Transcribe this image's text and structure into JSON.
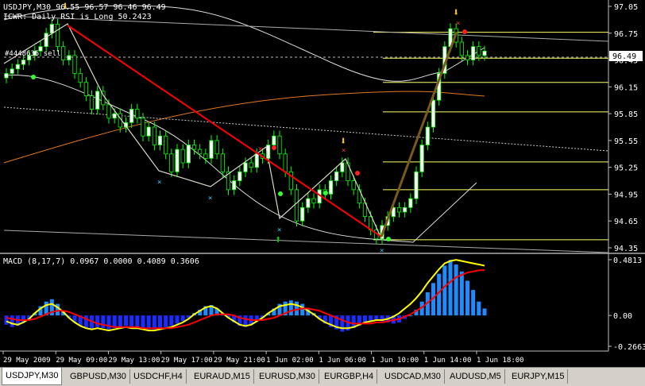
{
  "window": {
    "title": "USDJPY,M30  96.55 96.57 96.46 96.49",
    "indicator_line": "ICWR: Daily RSI is Long 50.2423",
    "order_label": "#4448635 sell"
  },
  "colors": {
    "background": "#000000",
    "grid": "#3a3a3a",
    "bull_candle": "#ffffff",
    "bear_candle": "#000000",
    "candle_outline": "#00ff00",
    "fib_lines": "#ffff66",
    "trend_red": "#ff0000",
    "zigzag": "#d8d8c8",
    "macd_hist": "#1e64ff",
    "macd_line": "#ffff00",
    "signal_line": "#ff0000"
  },
  "price_axis": {
    "labels": [
      "97.05",
      "96.75",
      "96.45",
      "96.15",
      "95.85",
      "95.55",
      "95.25",
      "94.95",
      "94.65",
      "94.35"
    ],
    "current_price": "96.49"
  },
  "macd_panel": {
    "title": "MACD  (8,17,7) 0.0967 0.0000 0.4089 0.3606",
    "axis_labels": [
      "0.4813",
      "0.00",
      "-0.2663"
    ]
  },
  "time_axis": {
    "labels": [
      "29 May 2009",
      "29 May 09:00",
      "29 May 13:00",
      "29 May 17:00",
      "29 May 21:00",
      "1 Jun 02:00",
      "1 Jun 06:00",
      "1 Jun 10:00",
      "1 Jun 14:00",
      "1 Jun 18:00"
    ]
  },
  "tabs": [
    {
      "label": "USDJPY,M30",
      "active": true
    },
    {
      "label": "GBPUSD,M30",
      "active": false
    },
    {
      "label": "USDCHF,H4",
      "active": false
    },
    {
      "label": "EURAUD,M15",
      "active": false
    },
    {
      "label": "EURUSD,M30",
      "active": false
    },
    {
      "label": "EURGBP,H4",
      "active": false
    },
    {
      "label": "USDCAD,M30",
      "active": false
    },
    {
      "label": "AUDUSD,M5",
      "active": false
    },
    {
      "label": "EURJPY,M15",
      "active": false
    }
  ],
  "chart_data": {
    "type": "candlestick",
    "symbol": "USDJPY",
    "timeframe": "M30",
    "ylim": [
      94.3,
      97.1
    ],
    "fib_levels": [
      96.76,
      96.47,
      96.2,
      95.87,
      95.31,
      95.0,
      94.44
    ],
    "closes": [
      96.3,
      96.35,
      96.4,
      96.45,
      96.5,
      96.55,
      96.6,
      96.75,
      96.85,
      96.6,
      96.45,
      96.5,
      96.3,
      96.2,
      96.05,
      95.9,
      96.1,
      95.95,
      95.8,
      95.85,
      95.7,
      95.75,
      95.9,
      95.8,
      95.6,
      95.7,
      95.5,
      95.6,
      95.4,
      95.2,
      95.45,
      95.3,
      95.5,
      95.45,
      95.4,
      95.35,
      95.55,
      95.4,
      95.2,
      95.0,
      95.1,
      95.2,
      95.3,
      95.25,
      95.4,
      95.35,
      95.5,
      95.6,
      95.4,
      95.2,
      95.0,
      94.65,
      94.8,
      94.9,
      94.85,
      95.0,
      94.95,
      95.1,
      95.2,
      95.3,
      95.1,
      95.0,
      94.85,
      94.7,
      94.55,
      94.45,
      94.6,
      94.7,
      94.8,
      94.75,
      94.8,
      94.9,
      95.2,
      95.5,
      95.7,
      96.0,
      96.3,
      96.6,
      96.8,
      96.65,
      96.5,
      96.45,
      96.6,
      96.5,
      96.55
    ],
    "macd_hist": [
      -0.08,
      -0.1,
      -0.09,
      -0.06,
      -0.03,
      0.02,
      0.08,
      0.12,
      0.14,
      0.1,
      0.04,
      -0.02,
      -0.06,
      -0.09,
      -0.11,
      -0.12,
      -0.1,
      -0.11,
      -0.12,
      -0.11,
      -0.1,
      -0.09,
      -0.1,
      -0.1,
      -0.11,
      -0.12,
      -0.12,
      -0.11,
      -0.1,
      -0.09,
      -0.07,
      -0.05,
      -0.02,
      0.02,
      0.05,
      0.08,
      0.09,
      0.06,
      0.02,
      -0.02,
      -0.06,
      -0.09,
      -0.1,
      -0.08,
      -0.05,
      -0.02,
      0.02,
      0.06,
      0.1,
      0.12,
      0.13,
      0.12,
      0.1,
      0.06,
      0.02,
      -0.03,
      -0.07,
      -0.1,
      -0.12,
      -0.14,
      -0.13,
      -0.11,
      -0.09,
      -0.07,
      -0.05,
      -0.04,
      -0.05,
      -0.06,
      -0.07,
      -0.06,
      -0.03,
      0.0,
      0.05,
      0.12,
      0.2,
      0.28,
      0.36,
      0.43,
      0.48,
      0.44,
      0.38,
      0.3,
      0.22,
      0.12,
      0.06
    ],
    "macd_line": [
      -0.05,
      -0.07,
      -0.08,
      -0.06,
      -0.03,
      0.02,
      0.06,
      0.09,
      0.1,
      0.07,
      0.03,
      -0.02,
      -0.06,
      -0.09,
      -0.11,
      -0.12,
      -0.11,
      -0.12,
      -0.13,
      -0.12,
      -0.11,
      -0.1,
      -0.11,
      -0.11,
      -0.12,
      -0.13,
      -0.13,
      -0.12,
      -0.11,
      -0.1,
      -0.08,
      -0.06,
      -0.03,
      0.01,
      0.04,
      0.07,
      0.08,
      0.06,
      0.02,
      -0.02,
      -0.05,
      -0.08,
      -0.09,
      -0.08,
      -0.05,
      -0.02,
      0.02,
      0.05,
      0.08,
      0.09,
      0.1,
      0.09,
      0.07,
      0.04,
      0.01,
      -0.03,
      -0.06,
      -0.08,
      -0.1,
      -0.11,
      -0.11,
      -0.1,
      -0.08,
      -0.06,
      -0.05,
      -0.04,
      -0.04,
      -0.03,
      -0.01,
      0.02,
      0.06,
      0.1,
      0.15,
      0.21,
      0.28,
      0.34,
      0.4,
      0.45,
      0.47,
      0.48,
      0.47,
      0.46,
      0.45,
      0.44,
      0.43
    ],
    "signal_line": [
      -0.02,
      -0.03,
      -0.04,
      -0.04,
      -0.04,
      -0.03,
      -0.01,
      0.01,
      0.03,
      0.04,
      0.04,
      0.03,
      0.01,
      -0.01,
      -0.03,
      -0.05,
      -0.07,
      -0.08,
      -0.09,
      -0.1,
      -0.1,
      -0.1,
      -0.1,
      -0.1,
      -0.11,
      -0.11,
      -0.11,
      -0.11,
      -0.11,
      -0.11,
      -0.1,
      -0.09,
      -0.08,
      -0.06,
      -0.04,
      -0.02,
      0.0,
      0.01,
      0.01,
      0.01,
      0.0,
      -0.02,
      -0.03,
      -0.04,
      -0.04,
      -0.04,
      -0.03,
      -0.02,
      0.0,
      0.02,
      0.04,
      0.05,
      0.06,
      0.06,
      0.05,
      0.04,
      0.02,
      0.0,
      -0.02,
      -0.04,
      -0.06,
      -0.07,
      -0.07,
      -0.07,
      -0.07,
      -0.06,
      -0.06,
      -0.05,
      -0.04,
      -0.03,
      -0.01,
      0.01,
      0.04,
      0.07,
      0.11,
      0.15,
      0.2,
      0.25,
      0.29,
      0.33,
      0.35,
      0.37,
      0.38,
      0.39,
      0.39
    ]
  }
}
